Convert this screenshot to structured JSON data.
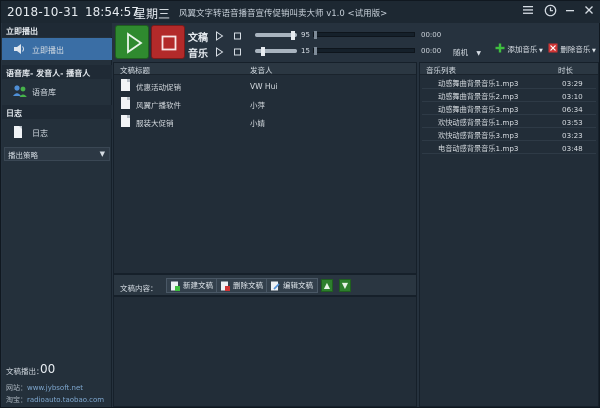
{
  "titlebar": {
    "date": "2018-10-31",
    "time": "18:54:57",
    "weekday": "星期三",
    "title": "风翼文字转语音播音宣传促销叫卖大师 v1.0 <试用版>"
  },
  "sidebar": {
    "sections": [
      {
        "head": "立即播出",
        "item": "立即播出"
      },
      {
        "head": "语音库- 发音人- 播音人",
        "item": "语音库"
      },
      {
        "head": "日志",
        "item": "日志"
      }
    ],
    "strategy": "播出策略",
    "doc_count_label": "文稿播出：",
    "doc_count": "00",
    "site_label": "网站：",
    "site_url": "www.jybsoft.net",
    "shop_label": "淘宝：",
    "shop_url": "radioauto.taobao.com"
  },
  "controls": {
    "doc_label": "文稿",
    "music_label": "音乐",
    "doc_volume": "95",
    "music_volume": "15",
    "doc_volume_level": 0.95,
    "music_volume_level": 0.15,
    "doc_time": "00:00",
    "music_time": "00:00",
    "mode": "随机",
    "add_music": "添加音乐",
    "del_music": "删除音乐"
  },
  "doc_table": {
    "col_title": "文稿标题",
    "col_speaker": "发音人",
    "rows": [
      {
        "title": "优惠活动促销",
        "speaker": "VW Hui"
      },
      {
        "title": "风翼广播软件",
        "speaker": "小萍"
      },
      {
        "title": "服装大促销",
        "speaker": "小婧"
      }
    ]
  },
  "content_bar": {
    "label": "文稿内容：",
    "new_doc": "新建文稿",
    "del_doc": "删除文稿",
    "edit_doc": "编辑文稿"
  },
  "music_table": {
    "col_name": "音乐列表",
    "col_duration": "时长",
    "rows": [
      {
        "name": "动感舞曲背景音乐1.mp3",
        "duration": "03:29"
      },
      {
        "name": "动感舞曲背景音乐2.mp3",
        "duration": "03:10"
      },
      {
        "name": "动感舞曲背景音乐3.mp3",
        "duration": "06:34"
      },
      {
        "name": "欢快动感背景音乐1.mp3",
        "duration": "03:53"
      },
      {
        "name": "欢快动感背景音乐3.mp3",
        "duration": "03:23"
      },
      {
        "name": "电音动感背景音乐1.mp3",
        "duration": "03:48"
      }
    ]
  },
  "colors": {
    "accent": "#3a6ea5",
    "play": "#2f8a2f",
    "stop": "#b32a2a"
  }
}
